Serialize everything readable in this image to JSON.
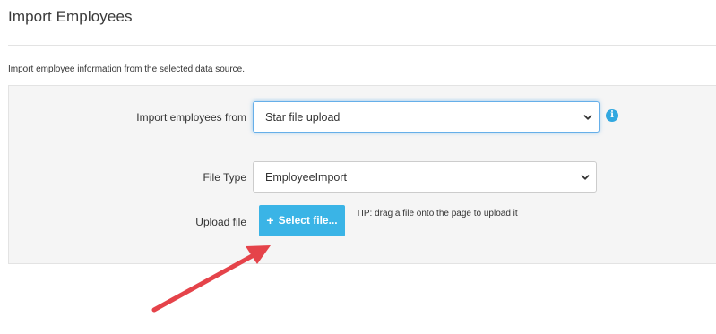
{
  "page": {
    "title": "Import Employees",
    "description": "Import employee information from the selected data source."
  },
  "form": {
    "import_from": {
      "label": "Import employees from",
      "value": "Star file upload"
    },
    "file_type": {
      "label": "File Type",
      "value": "EmployeeImport"
    },
    "upload": {
      "label": "Upload file",
      "button_label": "Select file...",
      "tip": "TIP: drag a file onto the page to upload it"
    },
    "info_icon_glyph": "i"
  },
  "icons": {
    "info": "info-icon",
    "plus": "plus-icon",
    "chevron": "chevron-down-icon",
    "annotation": "red-arrow-annotation"
  },
  "colors": {
    "accent": "#3ab4e6",
    "info": "#31a8e0",
    "focus": "#66afe9",
    "annotation_arrow": "#e5434a",
    "panel_bg": "#f5f5f5"
  }
}
